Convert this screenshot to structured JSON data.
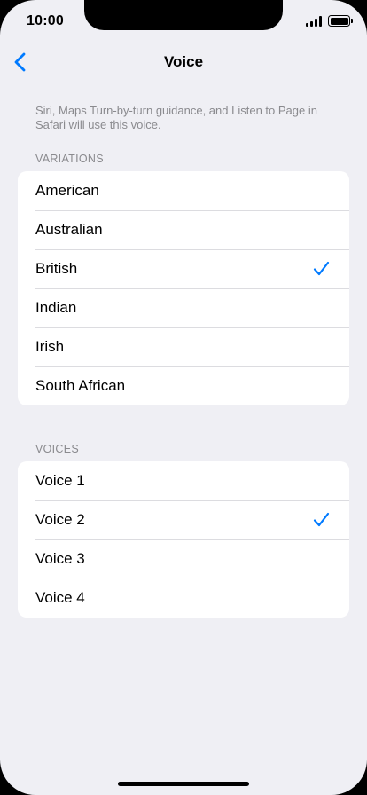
{
  "status_bar": {
    "time": "10:00"
  },
  "nav": {
    "title": "Voice",
    "back_icon": "chevron-left-icon"
  },
  "description": "Siri, Maps Turn-by-turn guidance, and Listen to Page in Safari will use this voice.",
  "variations": {
    "header": "VARIATIONS",
    "items": [
      {
        "label": "American",
        "selected": false
      },
      {
        "label": "Australian",
        "selected": false
      },
      {
        "label": "British",
        "selected": true
      },
      {
        "label": "Indian",
        "selected": false
      },
      {
        "label": "Irish",
        "selected": false
      },
      {
        "label": "South African",
        "selected": false
      }
    ]
  },
  "voices": {
    "header": "VOICES",
    "items": [
      {
        "label": "Voice 1",
        "selected": false
      },
      {
        "label": "Voice 2",
        "selected": true
      },
      {
        "label": "Voice 3",
        "selected": false
      },
      {
        "label": "Voice 4",
        "selected": false
      }
    ]
  },
  "colors": {
    "accent": "#007aff",
    "background": "#efeff4",
    "secondary_text": "#8a8a8e"
  }
}
